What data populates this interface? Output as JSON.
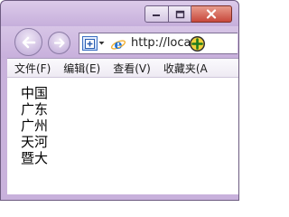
{
  "window": {
    "caption_buttons": [
      {
        "name": "minimize",
        "icon": "minimize-icon"
      },
      {
        "name": "maximize",
        "icon": "maximize-icon"
      },
      {
        "name": "close",
        "icon": "close-icon"
      }
    ]
  },
  "navigation": {
    "back_icon": "back-arrow-icon",
    "forward_icon": "forward-arrow-icon",
    "address": {
      "compat_icon": "compatibility-view-icon",
      "site_icon": "ie-logo-icon",
      "url": "http://loca",
      "go_icon": "go-arrow-icon"
    }
  },
  "menu": {
    "items": [
      {
        "label": "文件(F)"
      },
      {
        "label": "编辑(E)"
      },
      {
        "label": "查看(V)"
      },
      {
        "label": "收藏夹(A"
      }
    ]
  },
  "content": {
    "lines": [
      "中国",
      "广东",
      "广州",
      "天河",
      "暨大"
    ]
  },
  "colors": {
    "frame": "#c9b2dc",
    "close_button": "#c8483b",
    "accent_blue": "#3b6fc1"
  }
}
